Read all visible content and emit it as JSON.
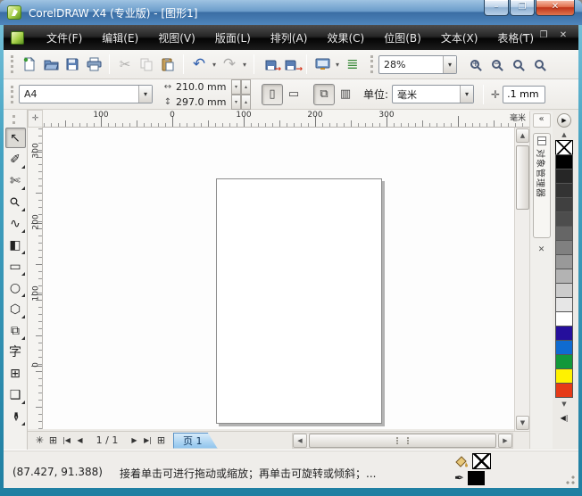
{
  "window": {
    "title": "CorelDRAW X4 (专业版) - [图形1]",
    "controls": {
      "minimize": "–",
      "maximize": "❐",
      "close": "✕"
    }
  },
  "menubar": {
    "items": [
      "文件(F)",
      "编辑(E)",
      "视图(V)",
      "版面(L)",
      "排列(A)",
      "效果(C)",
      "位图(B)",
      "文本(X)",
      "表格(T)"
    ],
    "mdi_controls": {
      "minimize": "–",
      "restore": "❐",
      "close": "✕"
    }
  },
  "toolbar": {
    "zoom_level": "28%",
    "icons": {
      "cut": "✂",
      "undo": "↶",
      "redo": "↷",
      "dropdown": "▾",
      "options": "≣",
      "zoom_in": "+",
      "zoom_out": "−",
      "arrow": "→"
    }
  },
  "property_bar": {
    "paper_size": "A4",
    "paper_width": "210.0 mm",
    "paper_height": "297.0 mm",
    "units_label": "单位:",
    "units_value": "毫米",
    "nudge_offset": ".1 mm",
    "icons": {
      "portrait": "▯",
      "landscape": "▭",
      "all_pages": "⧉",
      "current_page": "▥",
      "nudge": "✛",
      "spin_up": "▴",
      "spin_down": "▾",
      "dropdown": "▾",
      "width": "↔",
      "height": "↕"
    }
  },
  "toolbox": {
    "tools": [
      {
        "name": "pick-tool",
        "glyph": "↖",
        "selected": true,
        "flyout": false
      },
      {
        "name": "shape-tool",
        "glyph": "✐",
        "selected": false,
        "flyout": true
      },
      {
        "name": "crop-tool",
        "glyph": "✄",
        "selected": false,
        "flyout": true
      },
      {
        "name": "zoom-tool",
        "glyph": "⚲",
        "selected": false,
        "flyout": true
      },
      {
        "name": "freehand-tool",
        "glyph": "∿",
        "selected": false,
        "flyout": true
      },
      {
        "name": "smart-fill-tool",
        "glyph": "◧",
        "selected": false,
        "flyout": true
      },
      {
        "name": "rectangle-tool",
        "glyph": "▭",
        "selected": false,
        "flyout": true
      },
      {
        "name": "ellipse-tool",
        "glyph": "○",
        "selected": false,
        "flyout": true
      },
      {
        "name": "polygon-tool",
        "glyph": "⬡",
        "selected": false,
        "flyout": true
      },
      {
        "name": "basic-shapes-tool",
        "glyph": "⧉",
        "selected": false,
        "flyout": true
      },
      {
        "name": "text-tool",
        "glyph": "字",
        "selected": false,
        "flyout": false
      },
      {
        "name": "table-tool",
        "glyph": "⊞",
        "selected": false,
        "flyout": false
      },
      {
        "name": "blend-tool",
        "glyph": "❑",
        "selected": false,
        "flyout": true
      },
      {
        "name": "eyedropper-tool",
        "glyph": "✒",
        "selected": false,
        "flyout": true
      }
    ]
  },
  "rulers": {
    "origin": "✛",
    "horizontal_labels": [
      "100",
      "0",
      "100",
      "200",
      "300"
    ],
    "unit_label": "毫米",
    "vertical_labels": [
      "300",
      "200",
      "100",
      "0"
    ]
  },
  "docker": {
    "collapse": "«",
    "tab_title": "对象管理器",
    "close": "✕"
  },
  "palette": {
    "flyout": "▶",
    "scroll_up": "▲",
    "scroll_down": "▼",
    "expand": "◀|",
    "colors": [
      "none",
      "#000000",
      "#262626",
      "#333333",
      "#404040",
      "#4d4d4d",
      "#666666",
      "#808080",
      "#999999",
      "#b3b3b3",
      "#cccccc",
      "#e6e6e6",
      "#ffffff",
      "#250f9c",
      "#0f6bd0",
      "#12983a",
      "#fff200",
      "#e63a17"
    ]
  },
  "page_nav": {
    "navigator": "✳",
    "add_page_left": "⊞",
    "first": "|◀",
    "prev": "◀",
    "counter": "1 / 1",
    "next": "▶",
    "last": "▶|",
    "add_page_right": "⊞",
    "page_tab": "页 1"
  },
  "scrollbars": {
    "up": "▲",
    "down": "▼",
    "left": "◀",
    "right": "▶"
  },
  "status_bar": {
    "coordinates": "(87.427, 91.388)",
    "hint": "接着单击可进行拖动或缩放；再单击可旋转或倾斜；...",
    "fill_color": "none",
    "outline_color": "#000000",
    "outline_pen": "✒"
  },
  "colors": {
    "titlebar_accent": "#4f86bc",
    "frame": "#2f93b4",
    "page_tab_highlight": "#8cc2ec",
    "menubar": "#1c1c1c"
  }
}
